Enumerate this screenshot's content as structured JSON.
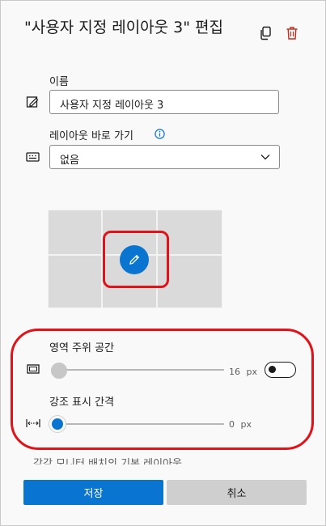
{
  "dialog": {
    "title": "\"사용자 지정 레이아웃 3\" 편집",
    "icons": [
      "copy-icon",
      "delete-icon"
    ],
    "accent_color": "#0a74d1",
    "delete_color": "#c42b1c",
    "annotation_color": "#e1131a"
  },
  "name_field": {
    "label": "이름",
    "value": "사용자 지정 레이아웃 3",
    "icon": "rename-icon"
  },
  "shortcut_field": {
    "label": "레이아웃 바로 가기",
    "value": "없음",
    "icons": [
      "info-icon",
      "keyboard-icon",
      "chevron-down-icon"
    ]
  },
  "layout_preview": {
    "edit_icon": "pencil-icon"
  },
  "spacing": {
    "label": "영역 주위 공간",
    "value_text": "16",
    "unit": "px",
    "enabled": false,
    "slider_fraction": 0
  },
  "highlight": {
    "label": "강조 표시 간격",
    "value_text": "0",
    "unit": "px",
    "slider_fraction": 0
  },
  "partial_text": "각각 모니터 배치의 기본 레이아웃",
  "footer": {
    "save_label": "저장",
    "cancel_label": "취소"
  }
}
